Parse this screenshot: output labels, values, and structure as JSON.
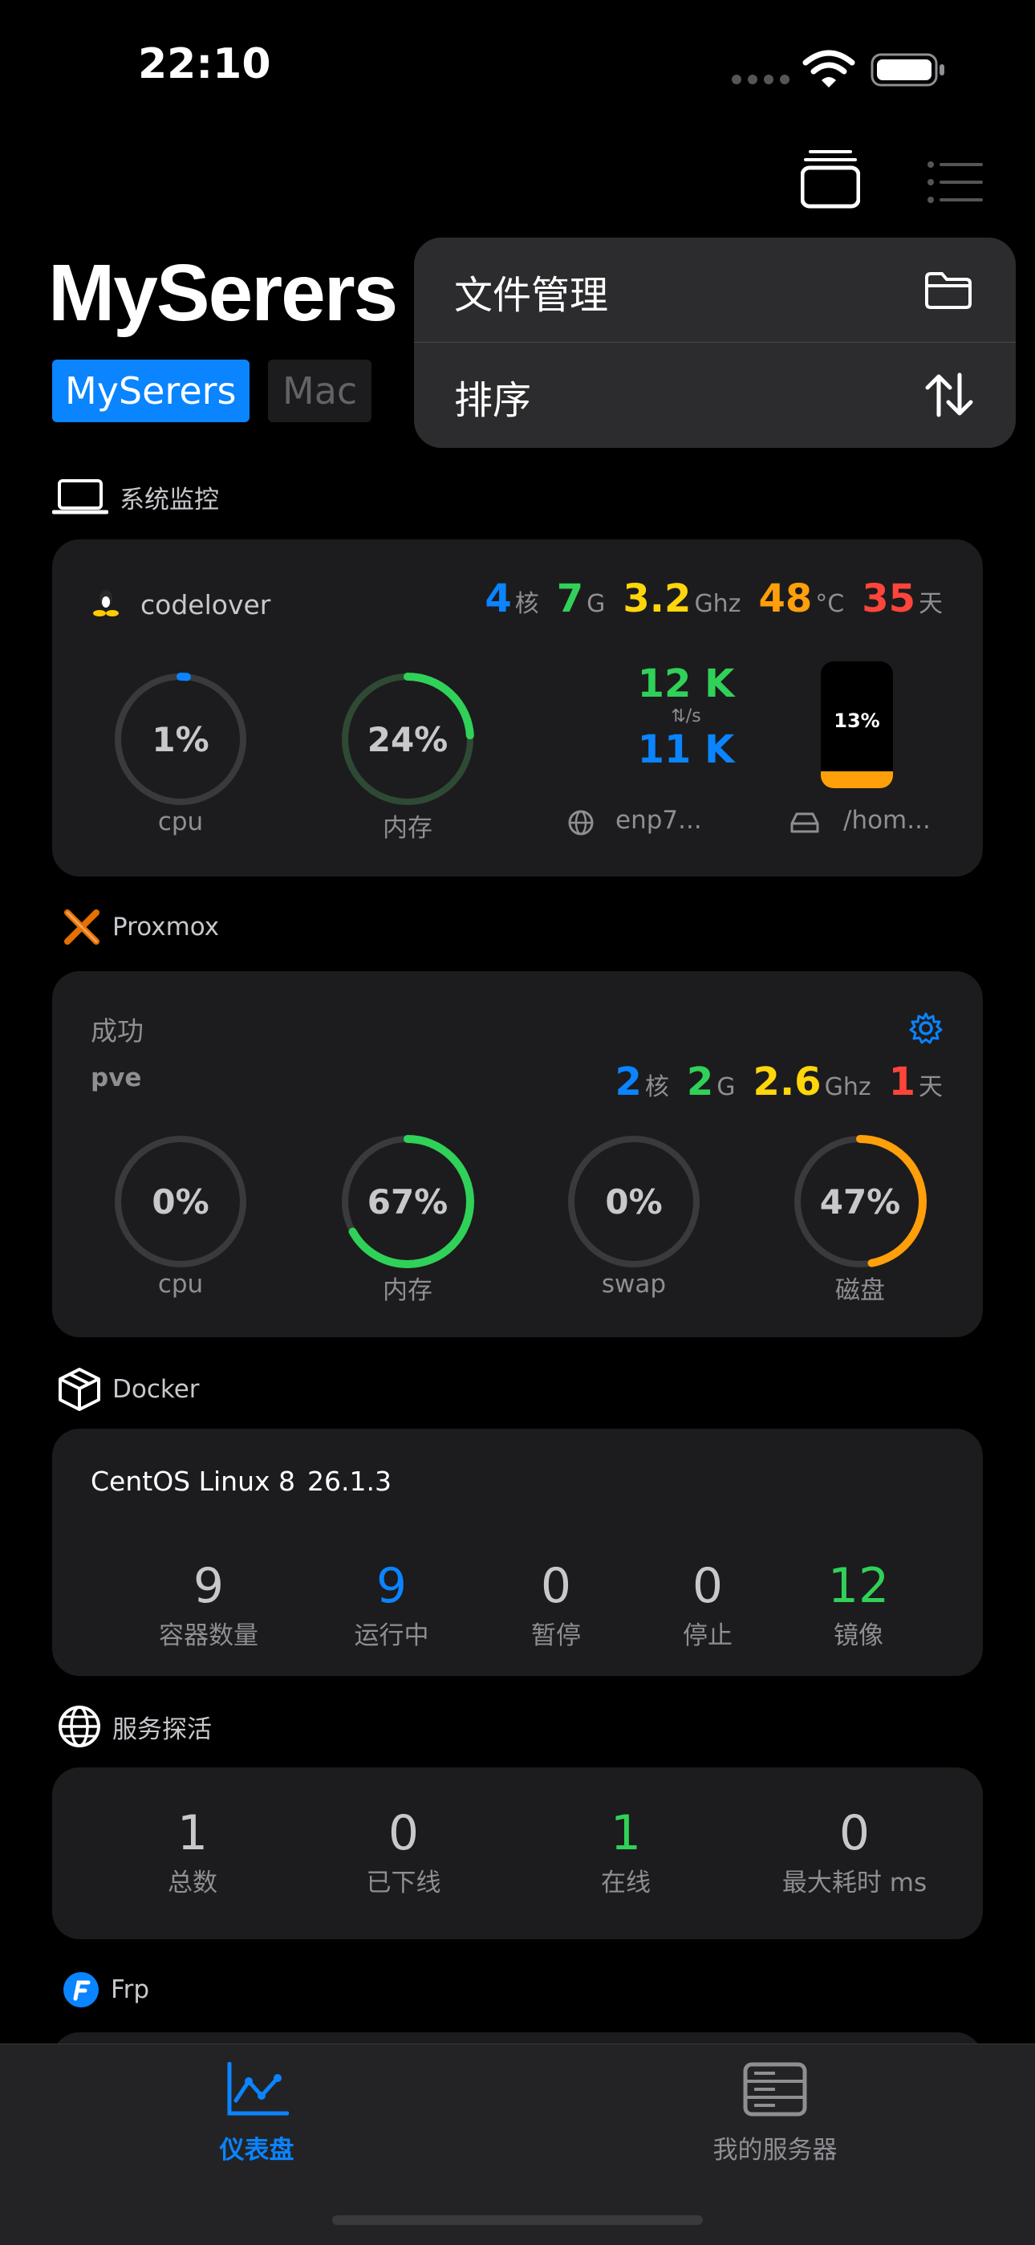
{
  "status_bar": {
    "time": "22:10"
  },
  "header": {
    "title": "MySerers",
    "tabs": [
      "MySerers",
      "Mac"
    ]
  },
  "menu": {
    "items": [
      {
        "label": "文件管理",
        "icon": "folder-icon"
      },
      {
        "label": "排序",
        "icon": "sort-arrows-icon"
      }
    ]
  },
  "system_monitor": {
    "section_title": "系统监控",
    "host": "codelover",
    "stats": {
      "cores": "4",
      "cores_unit": "核",
      "mem": "7",
      "mem_unit": "G",
      "freq": "3.2",
      "freq_unit": "Ghz",
      "temp": "48",
      "temp_unit": "°C",
      "uptime": "35",
      "uptime_unit": "天"
    },
    "cpu": {
      "label": "1%",
      "name": "cpu",
      "fraction": 0.01
    },
    "memory": {
      "label": "24%",
      "name": "内存",
      "fraction": 0.24
    },
    "network": {
      "up": "12 K",
      "down": "11 K",
      "unit": "⇅/s",
      "iface": "enp7..."
    },
    "disk": {
      "label": "13%",
      "fraction": 0.13,
      "mount": "/hom..."
    }
  },
  "proxmox": {
    "section_title": "Proxmox",
    "status": "成功",
    "node": "pve",
    "stats": {
      "cores": "2",
      "cores_unit": "核",
      "mem": "2",
      "mem_unit": "G",
      "freq": "2.6",
      "freq_unit": "Ghz",
      "uptime": "1",
      "uptime_unit": "天"
    },
    "rings": [
      {
        "label": "0%",
        "name": "cpu",
        "fraction": 0.0,
        "color": "#30d158"
      },
      {
        "label": "67%",
        "name": "内存",
        "fraction": 0.67,
        "color": "#30d158"
      },
      {
        "label": "0%",
        "name": "swap",
        "fraction": 0.0,
        "color": "#30d158"
      },
      {
        "label": "47%",
        "name": "磁盘",
        "fraction": 0.47,
        "color": "#ff9f0a"
      }
    ]
  },
  "docker": {
    "section_title": "Docker",
    "os": "CentOS Linux 8",
    "version": "26.1.3",
    "counters": [
      {
        "value": "9",
        "label": "容器数量"
      },
      {
        "value": "9",
        "label": "运行中"
      },
      {
        "value": "0",
        "label": "暂停"
      },
      {
        "value": "0",
        "label": "停止"
      },
      {
        "value": "12",
        "label": "镜像"
      }
    ]
  },
  "probe": {
    "section_title": "服务探活",
    "counters": [
      {
        "value": "1",
        "label": "总数"
      },
      {
        "value": "0",
        "label": "已下线"
      },
      {
        "value": "1",
        "label": "在线"
      },
      {
        "value": "0",
        "label": "最大耗时 ms"
      }
    ]
  },
  "frp": {
    "section_title": "Frp"
  },
  "tab_bar": {
    "items": [
      {
        "label": "仪表盘",
        "active": true
      },
      {
        "label": "我的服务器",
        "active": false
      }
    ]
  },
  "colors": {
    "accent": "#0a84ff",
    "green": "#30d158",
    "yellow": "#ffd60a",
    "orange": "#ff9f0a",
    "red": "#ff453a"
  }
}
